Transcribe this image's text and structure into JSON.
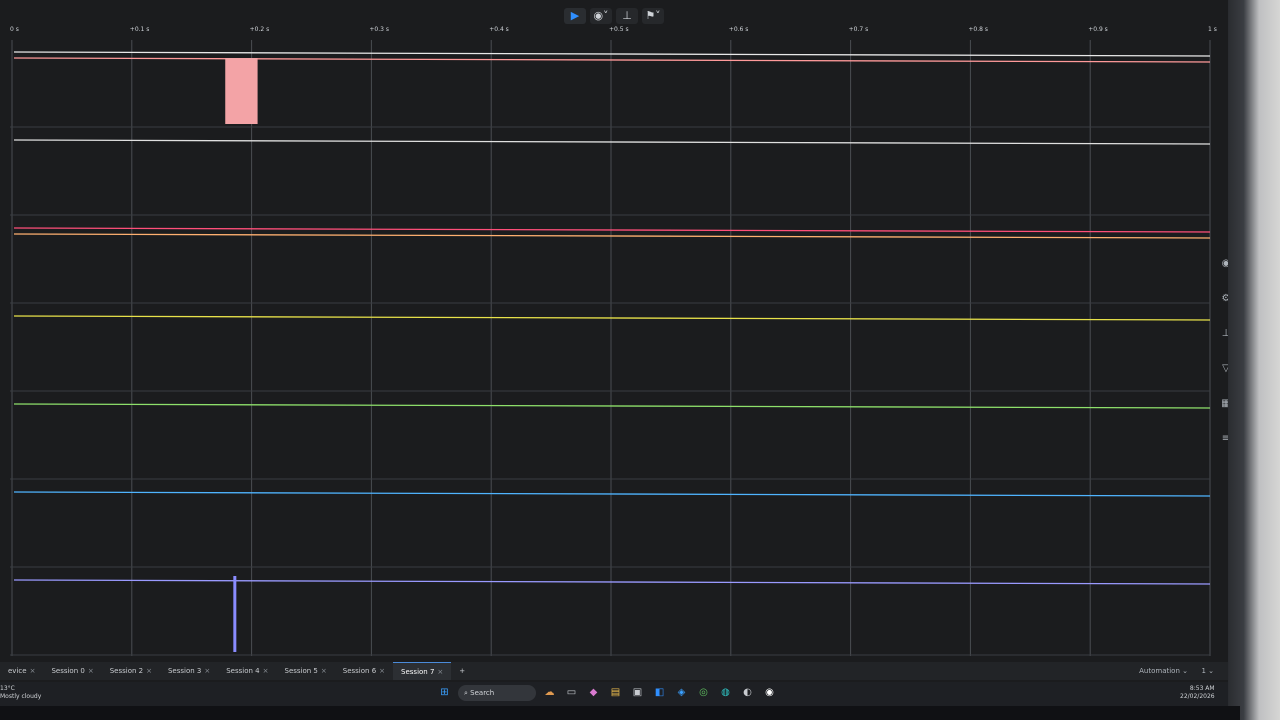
{
  "toolbar": {
    "buttons": [
      {
        "name": "play-button",
        "glyph": "▶"
      },
      {
        "name": "record-settings-button",
        "glyph": "◉˅"
      },
      {
        "name": "measure-button",
        "glyph": "⊥"
      },
      {
        "name": "analyzer-button",
        "glyph": "⚑˅"
      }
    ]
  },
  "ruler": {
    "ticks": [
      "0 s",
      "+0.1 s",
      "+0.2 s",
      "+0.3 s",
      "+0.4 s",
      "+0.5 s",
      "+0.6 s",
      "+0.7 s",
      "+0.8 s",
      "+0.9 s",
      "1 s"
    ]
  },
  "channels": [
    {
      "name": "channel-0",
      "colors": [
        "#e8e8e8",
        "#ff9a9a"
      ],
      "pulse": {
        "start": 0.178,
        "end": 0.205,
        "color": "#f3a3a6"
      }
    },
    {
      "name": "channel-1",
      "colors": [
        "#e0e0e0"
      ]
    },
    {
      "name": "channel-2",
      "colors": [
        "#ff4f7a",
        "#ffb070"
      ]
    },
    {
      "name": "channel-3",
      "colors": [
        "#e8e24a"
      ]
    },
    {
      "name": "channel-4",
      "colors": [
        "#8ee06b"
      ]
    },
    {
      "name": "channel-5",
      "colors": [
        "#4fb4ff"
      ]
    },
    {
      "name": "channel-6",
      "colors": [
        "#9a9aff"
      ],
      "spike": {
        "at": 0.186,
        "color": "#8a8cff"
      }
    }
  ],
  "side_tools": [
    {
      "name": "eye-icon",
      "glyph": "◉"
    },
    {
      "name": "settings-icon",
      "glyph": "⚙"
    },
    {
      "name": "cursor-icon",
      "glyph": "⊥"
    },
    {
      "name": "marker-icon",
      "glyph": "▽"
    },
    {
      "name": "grid-icon",
      "glyph": "▦"
    },
    {
      "name": "notes-icon",
      "glyph": "≡"
    }
  ],
  "sessions": {
    "tabs": [
      {
        "label": "evice",
        "active": false
      },
      {
        "label": "Session 0",
        "active": false
      },
      {
        "label": "Session 2",
        "active": false
      },
      {
        "label": "Session 3",
        "active": false
      },
      {
        "label": "Session 4",
        "active": false
      },
      {
        "label": "Session 5",
        "active": false
      },
      {
        "label": "Session 6",
        "active": false
      },
      {
        "label": "Session 7",
        "active": true
      }
    ],
    "add_label": "+",
    "automation_label": "Automation ⌄",
    "page_label": "1 ⌄"
  },
  "taskbar": {
    "weather_temp": "13°C",
    "weather_desc": "Mostly cloudy",
    "search_label": "Search",
    "icons": [
      {
        "name": "start-icon",
        "glyph": "⊞",
        "color": "#3aa0ff"
      },
      {
        "name": "widget-icon",
        "glyph": "☁",
        "color": "#e09a50"
      },
      {
        "name": "task-view-icon",
        "glyph": "▭",
        "color": "#c8cbd0"
      },
      {
        "name": "copilot-icon",
        "glyph": "◆",
        "color": "#d97ad0"
      },
      {
        "name": "file-explorer-icon",
        "glyph": "▤",
        "color": "#f2c14e"
      },
      {
        "name": "store-icon",
        "glyph": "▣",
        "color": "#c8cbd0"
      },
      {
        "name": "vscode-icon",
        "glyph": "◧",
        "color": "#2f8fff"
      },
      {
        "name": "app-icon",
        "glyph": "◈",
        "color": "#3aa0ff"
      },
      {
        "name": "chrome-icon",
        "glyph": "◎",
        "color": "#60c060"
      },
      {
        "name": "edge-icon",
        "glyph": "◍",
        "color": "#2ec4c4"
      },
      {
        "name": "steam-icon",
        "glyph": "◐",
        "color": "#c8cbd0"
      },
      {
        "name": "logic-icon",
        "glyph": "◉",
        "color": "#ffffff"
      }
    ],
    "time": "8:53 AM",
    "date": "22/02/2026"
  }
}
